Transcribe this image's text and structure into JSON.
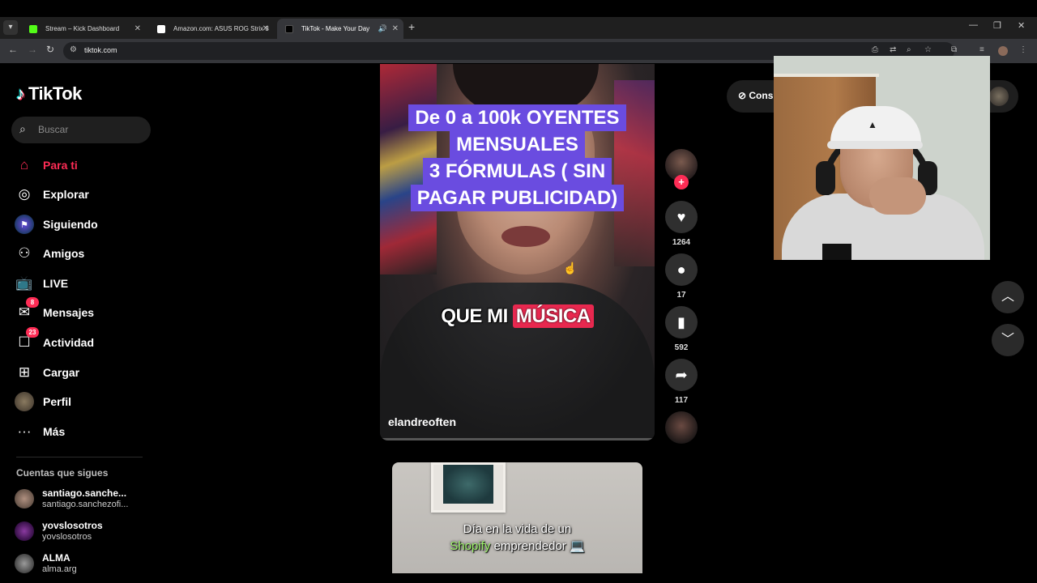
{
  "browser": {
    "tabs": [
      {
        "title": "Stream – Kick Dashboard",
        "favicon_color": "#53fc18"
      },
      {
        "title": "Amazon.com: ASUS ROG Strix 3",
        "favicon_color": "#ffffff"
      },
      {
        "title": "TikTok - Make Your Day",
        "favicon_color": "#000000",
        "active": true
      }
    ],
    "url": "tiktok.com"
  },
  "brand": {
    "name": "TikTok"
  },
  "search": {
    "placeholder": "Buscar"
  },
  "nav": [
    {
      "label": "Para ti",
      "icon": "home-icon",
      "active": true
    },
    {
      "label": "Explorar",
      "icon": "compass-icon"
    },
    {
      "label": "Siguiendo",
      "icon": "following-icon"
    },
    {
      "label": "Amigos",
      "icon": "friends-icon"
    },
    {
      "label": "LIVE",
      "icon": "live-tv-icon"
    },
    {
      "label": "Mensajes",
      "icon": "messages-icon",
      "badge": "8"
    },
    {
      "label": "Actividad",
      "icon": "activity-icon",
      "badge": "23"
    },
    {
      "label": "Cargar",
      "icon": "upload-icon"
    },
    {
      "label": "Perfil",
      "icon": "profile-avatar"
    },
    {
      "label": "Más",
      "icon": "more-icon"
    }
  ],
  "following": {
    "title": "Cuentas que sigues",
    "accounts": [
      {
        "name": "santiago.sanche...",
        "handle": "santiago.sanchezofi..."
      },
      {
        "name": "yovslosotros",
        "handle": "yovslosotros"
      },
      {
        "name": "ALMA",
        "handle": "alma.arg"
      }
    ]
  },
  "video": {
    "caption_lines": [
      "De 0 a 100k OYENTES",
      "MENSUALES",
      "3 FÓRMULAS ( SIN",
      "PAGAR PUBLICIDAD)"
    ],
    "subtitle_plain": "QUE MI",
    "subtitle_highlight": "MÚSICA",
    "author": "elandreoften",
    "likes": "1264",
    "comments": "17",
    "saves": "592",
    "shares": "117"
  },
  "next_video": {
    "caption_line1": "Día en la vida de un",
    "caption_green": "Shopify",
    "caption_rest": "emprendedor 💻"
  },
  "consult": {
    "label": "Cons"
  },
  "colors": {
    "accent": "#fe2c55",
    "caption_bg": "#6a4ce0"
  }
}
